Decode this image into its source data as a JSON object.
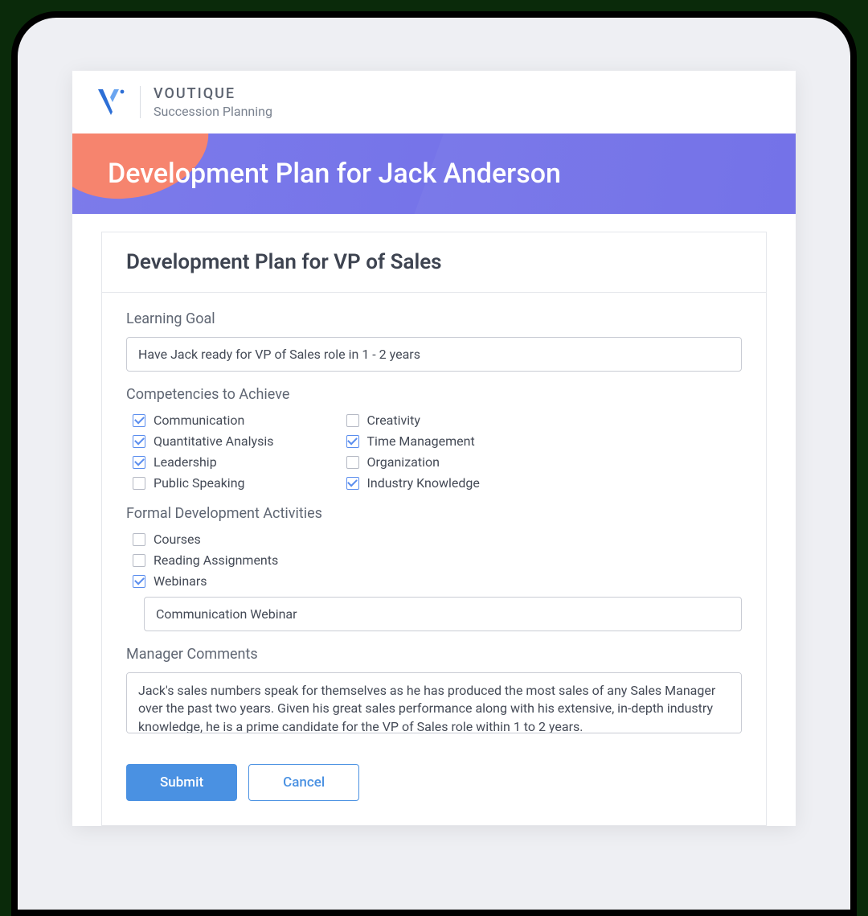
{
  "brand": {
    "title": "VOUTIQUE",
    "subtitle": "Succession Planning"
  },
  "banner": {
    "title": "Development Plan for Jack Anderson"
  },
  "card": {
    "title": "Development Plan for VP of Sales"
  },
  "sections": {
    "learning_goal": {
      "label": "Learning Goal",
      "value": "Have Jack ready for VP of Sales role in 1 - 2 years"
    },
    "competencies": {
      "label": "Competencies to Achieve",
      "col1": [
        {
          "label": "Communication",
          "checked": true
        },
        {
          "label": "Quantitative Analysis",
          "checked": true
        },
        {
          "label": "Leadership",
          "checked": true
        },
        {
          "label": "Public Speaking",
          "checked": false
        }
      ],
      "col2": [
        {
          "label": "Creativity",
          "checked": false
        },
        {
          "label": "Time Management",
          "checked": true
        },
        {
          "label": "Organization",
          "checked": false
        },
        {
          "label": "Industry Knowledge",
          "checked": true
        }
      ]
    },
    "activities": {
      "label": "Formal Development Activities",
      "items": [
        {
          "label": "Courses",
          "checked": false
        },
        {
          "label": "Reading Assignments",
          "checked": false
        },
        {
          "label": "Webinars",
          "checked": true
        }
      ],
      "detail_value": "Communication Webinar"
    },
    "comments": {
      "label": "Manager Comments",
      "value": "Jack's sales numbers speak for themselves as he has produced the most sales of any Sales Manager over the past two years. Given his great sales performance along with his extensive, in-depth industry knowledge, he is a prime candidate for the VP of Sales role within 1 to 2 years."
    }
  },
  "actions": {
    "submit": "Submit",
    "cancel": "Cancel"
  }
}
